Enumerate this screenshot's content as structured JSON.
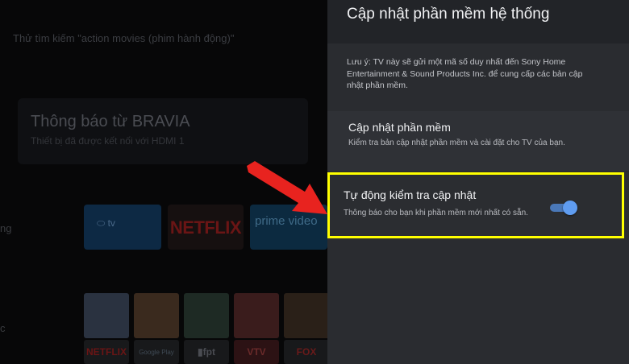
{
  "home": {
    "search_hint": "Thử tìm kiếm \"action movies (phim hành động)\"",
    "notification": {
      "title": "Thông báo từ BRAVIA",
      "subtitle": "Thiết bị đã được kết nối với HDMI 1"
    },
    "side_label": "ng",
    "side_label_2": "c",
    "tiles": {
      "tv": "⬭ tv",
      "netflix": "NETFLIX",
      "prime": "prime video"
    },
    "apps": {
      "netflix": "NETFLIX",
      "google_play": "Google Play",
      "fptplay": "▮fpt",
      "vtv": "VTV",
      "foxplay": "FOX"
    }
  },
  "settings": {
    "title": "Cập nhật phần mềm hệ thống",
    "note": "Lưu ý: TV này sẽ gửi một mã số duy nhất đến Sony Home Entertainment & Sound Products Inc. để cung cấp các bản cập nhật phần mềm.",
    "items": [
      {
        "title": "Cập nhật phần mềm",
        "description": "Kiểm tra bản cập nhật phần mềm và cài đặt cho TV của bạn."
      },
      {
        "title": "Tự động kiểm tra cập nhật",
        "description": "Thông báo cho bạn khi phần mềm mới nhất có sẵn.",
        "toggle_on": true
      }
    ]
  },
  "colors": {
    "highlight": "#ffff00",
    "arrow": "#e8231f",
    "toggle_accent": "#5f9cf0"
  }
}
